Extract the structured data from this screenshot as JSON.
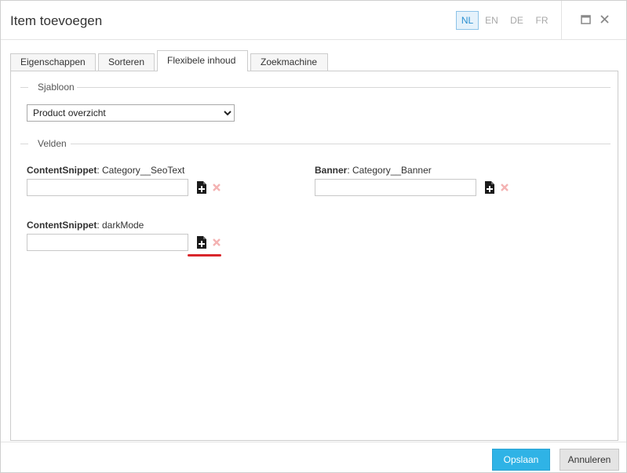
{
  "dialog": {
    "title": "Item toevoegen",
    "languages": [
      "NL",
      "EN",
      "DE",
      "FR"
    ],
    "active_language": "NL"
  },
  "tabs": [
    {
      "label": "Eigenschappen",
      "active": false
    },
    {
      "label": "Sorteren",
      "active": false
    },
    {
      "label": "Flexibele inhoud",
      "active": true
    },
    {
      "label": "Zoekmachine",
      "active": false
    }
  ],
  "sections": {
    "template": {
      "legend": "Sjabloon",
      "selected": "Product overzicht"
    },
    "fields": {
      "legend": "Velden",
      "items": [
        {
          "type": "ContentSnippet",
          "name": ": Category__SeoText",
          "value": ""
        },
        {
          "type": "Banner",
          "name": ": Category__Banner",
          "value": ""
        },
        {
          "type": "ContentSnippet",
          "name": ": darkMode",
          "value": ""
        }
      ]
    }
  },
  "footer": {
    "save_label": "Opslaan",
    "cancel_label": "Annuleren"
  },
  "colors": {
    "primary": "#2fb3e6",
    "active_lang_text": "#2a8fd0",
    "remove_icon": "#f4b3b3",
    "highlight": "#d9262b"
  }
}
